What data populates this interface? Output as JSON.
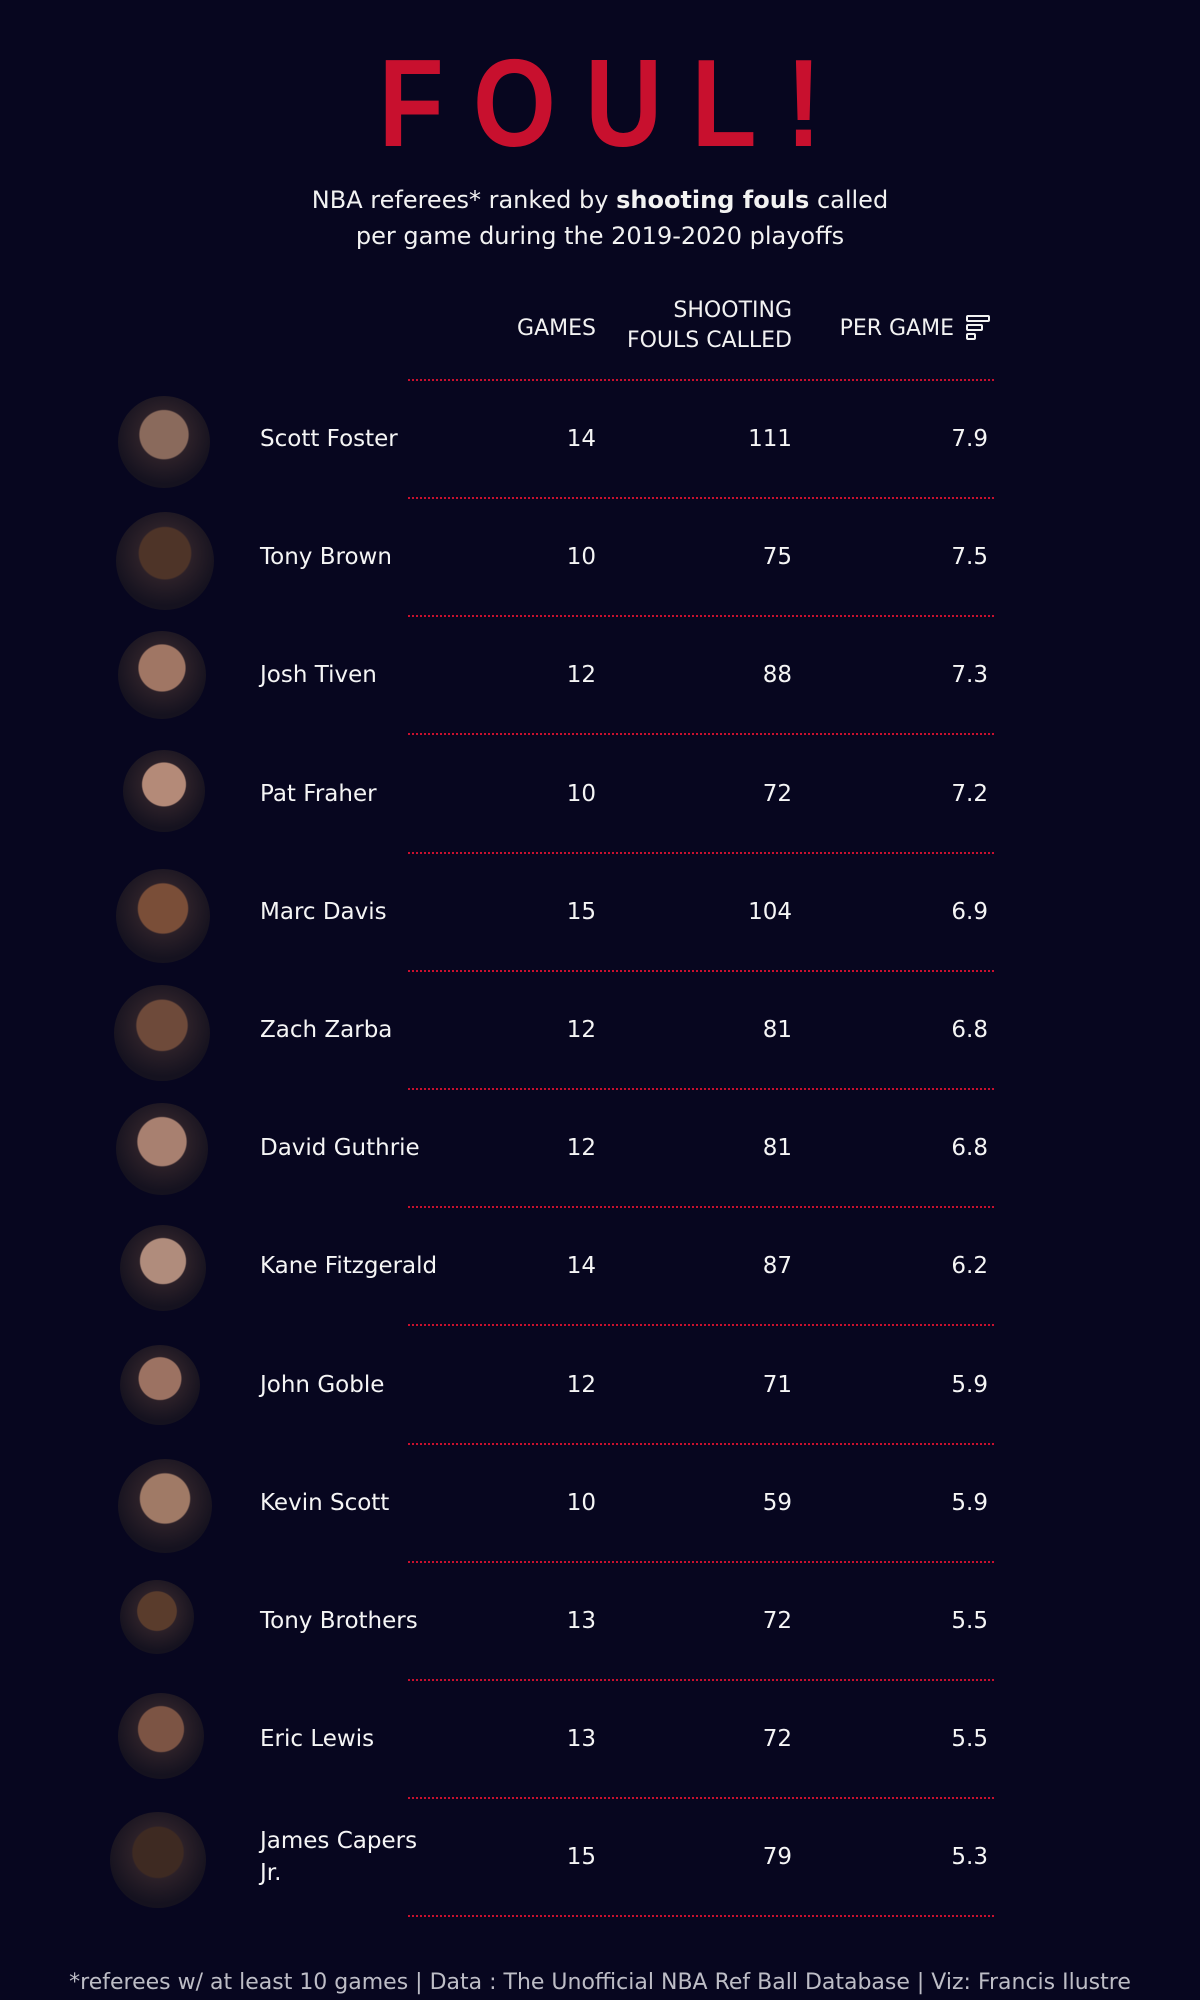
{
  "title": "FOUL!",
  "subtitle": {
    "line1_pre": "NBA referees* ranked by ",
    "line1_bold": "shooting fouls",
    "line1_post": " called",
    "line2": "per game during the 2019-2020 playoffs"
  },
  "headers": {
    "games": "GAMES",
    "fouls_line1": "SHOOTING",
    "fouls_line2": "FOULS CALLED",
    "per_game": "PER GAME",
    "sort_icon": "sort-descending-icon"
  },
  "chart_data": {
    "type": "table",
    "columns": [
      "GAMES",
      "SHOOTING FOULS CALLED",
      "PER GAME"
    ],
    "rows": [
      {
        "name": "Scott Foster",
        "games": "14",
        "fouls": "111",
        "per_game": "7.9"
      },
      {
        "name": "Tony Brown",
        "games": "10",
        "fouls": "75",
        "per_game": "7.5"
      },
      {
        "name": "Josh Tiven",
        "games": "12",
        "fouls": "88",
        "per_game": "7.3"
      },
      {
        "name": "Pat Fraher",
        "games": "10",
        "fouls": "72",
        "per_game": "7.2"
      },
      {
        "name": "Marc Davis",
        "games": "15",
        "fouls": "104",
        "per_game": "6.9"
      },
      {
        "name": "Zach Zarba",
        "games": "12",
        "fouls": "81",
        "per_game": "6.8"
      },
      {
        "name": "David Guthrie",
        "games": "12",
        "fouls": "81",
        "per_game": "6.8"
      },
      {
        "name": "Kane Fitzgerald",
        "games": "14",
        "fouls": "87",
        "per_game": "6.2"
      },
      {
        "name": "John Goble",
        "games": "12",
        "fouls": "71",
        "per_game": "5.9"
      },
      {
        "name": "Kevin Scott",
        "games": "10",
        "fouls": "59",
        "per_game": "5.9"
      },
      {
        "name": "Tony Brothers",
        "games": "13",
        "fouls": "72",
        "per_game": "5.5"
      },
      {
        "name": "Eric Lewis",
        "games": "13",
        "fouls": "72",
        "per_game": "5.5"
      },
      {
        "name": "James Capers Jr.",
        "games": "15",
        "fouls": "79",
        "per_game": "5.3"
      }
    ]
  },
  "colors": {
    "background": "#07061f",
    "accent_red": "#c8102e",
    "text": "#f5f5f5"
  },
  "footer": "*referees w/ at least 10 games | Data : The Unofficial NBA Ref Ball Database | Viz: Francis Ilustre"
}
